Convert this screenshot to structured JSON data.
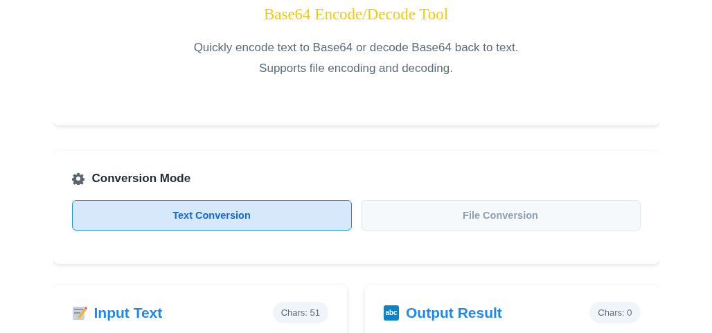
{
  "header": {
    "title": "Base64 Encode/Decode Tool",
    "description_lines": [
      "Quickly encode text to Base64 or decode Base64 back to text.",
      "Supports file encoding and decoding."
    ]
  },
  "mode_panel": {
    "title": "Conversion Mode",
    "modes": [
      {
        "label": "Text Conversion",
        "selected": true
      },
      {
        "label": "File Conversion",
        "selected": false
      }
    ]
  },
  "panels": [
    {
      "kind": "input",
      "title": "Input Text",
      "count": "Chars: 51"
    },
    {
      "kind": "output",
      "title": "Output Result",
      "icon_label": "abc",
      "count": "Chars: 0"
    }
  ]
}
